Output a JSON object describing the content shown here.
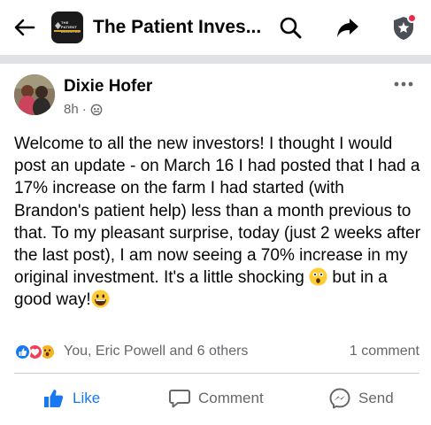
{
  "header": {
    "back_icon": "arrow-left-icon",
    "group_thumbnail_text": "THE PATIENT INVESTOR",
    "group_title": "The Patient Inves...",
    "search_icon": "search-icon",
    "share_icon": "share-arrow-icon",
    "admin_icon": "shield-star-icon",
    "notification_dot_color": "#f02849"
  },
  "post": {
    "author": "Dixie Hofer",
    "time": "8h",
    "separator": "·",
    "audience_icon": "privacy-icon",
    "more_icon": "more-dots-icon",
    "body": [
      {
        "type": "text",
        "value": "Welcome to all the new investors!  I thought I would post an update - on March 16 I had posted that I had a 17% increase on the farm I had started (with Brandon's patient help) less than a month previous to that.  To my pleasant surprise, today (just 2 weeks after the last post), I am now seeing a 70% increase in my original investment. It's a little shocking "
      },
      {
        "type": "emoji",
        "value": "astonished-face-emoji"
      },
      {
        "type": "text",
        "value": " but in a good way!"
      },
      {
        "type": "emoji",
        "value": "grinning-face-emoji"
      }
    ]
  },
  "reactions": {
    "types": [
      "like",
      "love",
      "wow"
    ],
    "names_text": "You, Eric Powell and 6 others",
    "comment_count": "1 comment"
  },
  "actions": {
    "like_label": "Like",
    "comment_label": "Comment",
    "send_label": "Send",
    "accent_color": "#1877f2",
    "muted_color": "#65676b"
  }
}
